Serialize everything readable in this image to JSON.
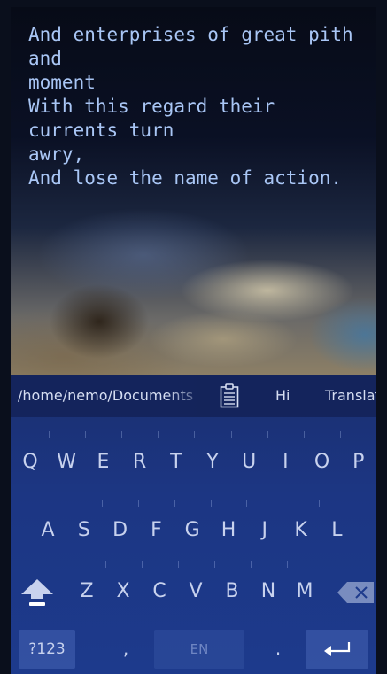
{
  "note": {
    "text": "And enterprises of great pith and\nmoment\nWith this regard their currents turn\nawry,\nAnd lose the name of action."
  },
  "suggestions": {
    "path": "/home/nemo/Documents",
    "clipboard_icon": "clipboard-icon",
    "hi": "Hi",
    "translate": "Translate"
  },
  "keyboard": {
    "row1": [
      "Q",
      "W",
      "E",
      "R",
      "T",
      "Y",
      "U",
      "I",
      "O",
      "P"
    ],
    "row2": [
      "A",
      "S",
      "D",
      "F",
      "G",
      "H",
      "J",
      "K",
      "L"
    ],
    "row3": [
      "Z",
      "X",
      "C",
      "V",
      "B",
      "N",
      "M"
    ],
    "symbols_label": "?123",
    "comma_label": ",",
    "space_label": "EN",
    "period_label": ".",
    "shift_icon": "shift-icon",
    "backspace_icon": "backspace-icon",
    "enter_icon": "enter-icon"
  },
  "colors": {
    "text_accent": "#a9c6f5",
    "keyboard_bg": "#1c3683"
  }
}
